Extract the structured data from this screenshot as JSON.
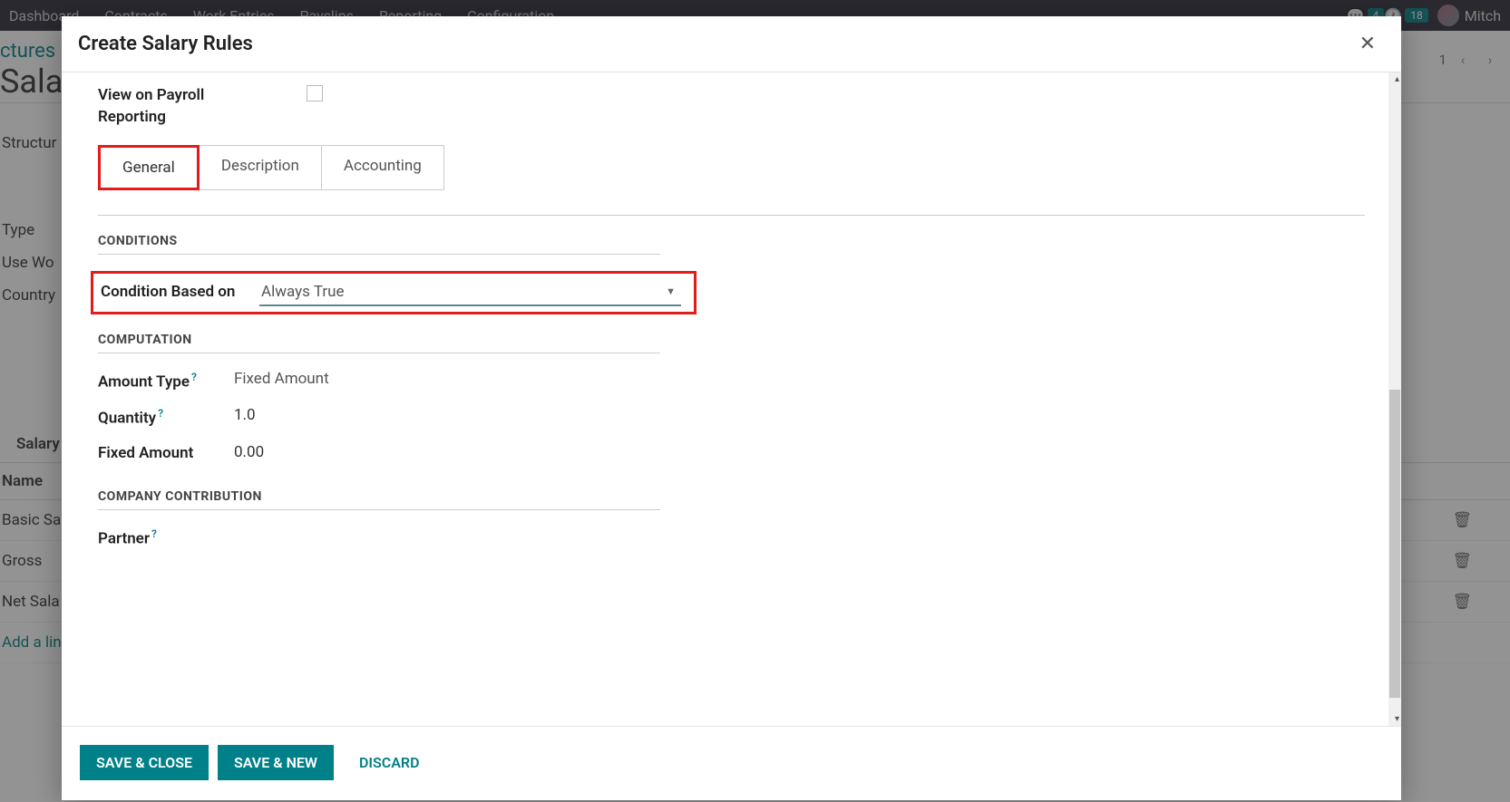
{
  "topnav": {
    "items": [
      "Dashboard",
      "Contracts",
      "Work Entries",
      "Payslips",
      "Reporting",
      "Configuration"
    ],
    "chat_badge": "4",
    "clock_badge": "18",
    "user": "Mitch"
  },
  "bg": {
    "breadcrumb": "ctures",
    "heading": "Sala",
    "pager_count": "1",
    "fields": {
      "structure": "Structur",
      "type": "Type",
      "use_worked": "Use Wo",
      "country": "Country"
    },
    "table": {
      "section": "Salary",
      "name_col": "Name",
      "rows": [
        "Basic Sa",
        "Gross",
        "Net Sala"
      ],
      "add": "Add a lin"
    }
  },
  "modal": {
    "title": "Create Salary Rules",
    "view_on_payroll": "View on Payroll Reporting",
    "tabs": {
      "general": "General",
      "description": "Description",
      "accounting": "Accounting"
    },
    "sections": {
      "conditions": "CONDITIONS",
      "computation": "COMPUTATION",
      "company_contribution": "COMPANY CONTRIBUTION"
    },
    "condition_based_on": {
      "label": "Condition Based on",
      "value": "Always True"
    },
    "amount_type": {
      "label": "Amount Type",
      "value": "Fixed Amount"
    },
    "quantity": {
      "label": "Quantity",
      "value": "1.0"
    },
    "fixed_amount": {
      "label": "Fixed Amount",
      "value": "0.00"
    },
    "partner": {
      "label": "Partner",
      "value": ""
    },
    "buttons": {
      "save_close": "SAVE & CLOSE",
      "save_new": "SAVE & NEW",
      "discard": "DISCARD"
    }
  }
}
